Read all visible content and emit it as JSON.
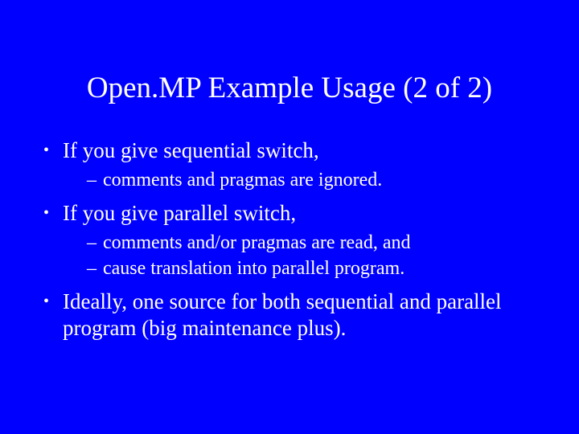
{
  "title": "Open.MP Example Usage (2 of 2)",
  "bullets": {
    "b1": "If you give sequential switch,",
    "b1s1": "comments and pragmas are ignored.",
    "b2": "If you give parallel switch,",
    "b2s1": "comments and/or pragmas are read, and",
    "b2s2": "cause translation into parallel program.",
    "b3": "Ideally, one source for both sequential and parallel program (big maintenance plus)."
  }
}
